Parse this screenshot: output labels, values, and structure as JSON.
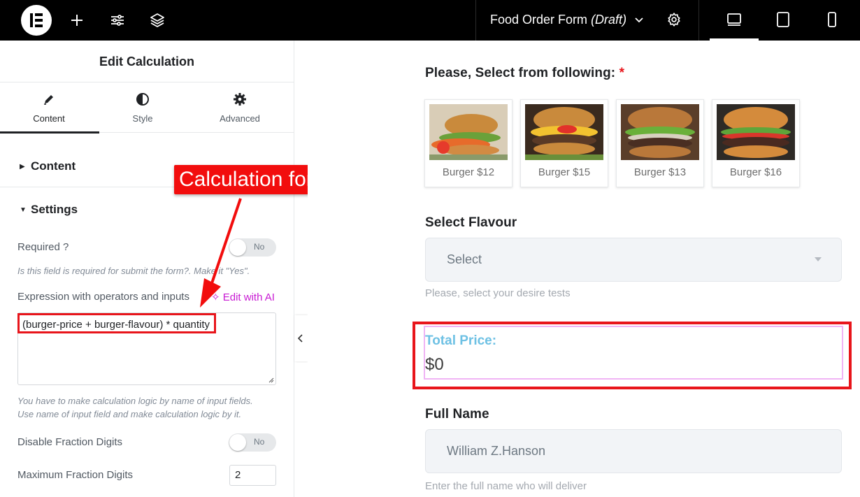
{
  "topbar": {
    "doc_title": "Food Order Form",
    "doc_status": "(Draft)"
  },
  "panel": {
    "title": "Edit Calculation",
    "tabs": [
      {
        "label": "Content",
        "icon": "pencil-icon"
      },
      {
        "label": "Style",
        "icon": "half-circle-icon"
      },
      {
        "label": "Advanced",
        "icon": "gear-icon"
      }
    ],
    "sections": {
      "content": "Content",
      "settings": "Settings"
    },
    "required": {
      "label": "Required ?",
      "toggle": "No",
      "help": "Is this field is required for submit the form?. Make it \"Yes\"."
    },
    "expression": {
      "label": "Expression with operators and inputs",
      "ai_link": "Edit with AI",
      "value": "(burger-price + burger-flavour) * quantity",
      "help_line1": "You have to make calculation logic by name of input fields.",
      "help_line2": "Use name of input field and make calculation logic by it."
    },
    "fraction": {
      "label": "Disable Fraction Digits",
      "toggle": "No"
    },
    "max_fraction": {
      "label": "Maximum Fraction Digits",
      "value": "2"
    }
  },
  "annotation": {
    "callout": "Calculation formula",
    "color": "#f20d0d"
  },
  "form": {
    "select_label": "Please, Select from following:",
    "required_mark": "*",
    "burgers": [
      {
        "caption": "Burger $12"
      },
      {
        "caption": "Burger $15"
      },
      {
        "caption": "Burger $13"
      },
      {
        "caption": "Burger $16"
      }
    ],
    "flavour": {
      "label": "Select Flavour",
      "value": "Select",
      "hint": "Please, select your desire tests"
    },
    "total": {
      "label": "Total Price:",
      "value": "$0"
    },
    "full_name": {
      "label": "Full Name",
      "placeholder": "William Z.Hanson",
      "hint": "Enter the full name who will deliver"
    }
  },
  "colors": {
    "accent_ai": "#c81ad3",
    "highlight_red": "#e8151b",
    "price_label": "#6ec1e4"
  }
}
